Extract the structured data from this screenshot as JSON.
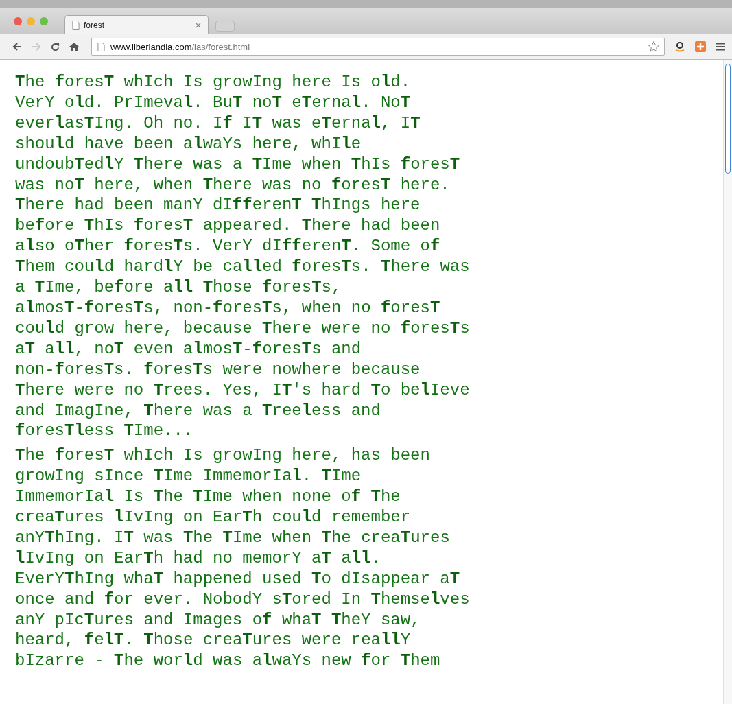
{
  "browser": {
    "tab": {
      "title": "forest"
    },
    "forward_disabled": true,
    "address": {
      "host": "www.liberlandia.com",
      "path": "/las/forest.html"
    }
  },
  "page": {
    "paragraphs": [
      {
        "lines": [
          "**T**he **f**ores**T** whIch Is growIng here Is o**l**d.",
          "VerY o**l**d. PrImeva**l**. Bu**T** no**T** e**T**erna**l**. No**T**",
          "ever**l**as**T**Ing. Oh no. I**f** I**T** was e**T**erna**l**, I**T**",
          "shou**l**d have been a**l**waYs here, whI**l**e",
          "undoub**T**ed**l**Y **T**here was a **T**Ime when **T**hIs **f**ores**T**",
          "was no**T** here, when **T**here was no **f**ores**T** here.",
          "**T**here had been manY dI**ff**eren**T** **T**hIngs here",
          "be**f**ore **T**hIs **f**ores**T** appeared. **T**here had been",
          "a**l**so o**T**her **f**ores**T**s. VerY dI**ff**eren**T**. Some o**f**",
          "**T**hem cou**l**d hard**l**Y be ca**ll**ed **f**ores**T**s. **T**here was",
          "a **T**Ime, be**f**ore a**ll** **T**hose **f**ores**T**s,",
          "a**l**mos**T**-**f**ores**T**s, non-**f**ores**T**s, when no **f**ores**T**",
          "cou**l**d grow here, because **T**here were no **f**ores**T**s",
          "a**T** a**ll**, no**T** even a**l**mos**T**-**f**ores**T**s and",
          "non-**f**ores**T**s. **f**ores**T**s were nowhere because",
          "**T**here were no **T**rees. Yes, I**T**'s hard **T**o be**l**Ieve",
          "and ImagIne, **T**here was a **T**ree**l**ess and",
          "**f**ores**Tl**ess **T**Ime..."
        ]
      },
      {
        "lines": [
          "**T**he **f**ores**T** whIch Is growIng here, has been",
          "growIng sInce **T**Ime ImmemorIa**l**. **T**Ime",
          "ImmemorIa**l** Is **T**he **T**Ime when none o**f** **T**he",
          "crea**T**ures **l**IvIng on Ear**T**h cou**l**d remember",
          "anY**T**hIng. I**T** was **T**he **T**Ime when **T**he crea**T**ures",
          "**l**IvIng on Ear**T**h had no memorY a**T** a**ll**.",
          "EverY**T**hIng wha**T** happened used **T**o dIsappear a**T**",
          "once and **f**or ever. NobodY s**T**ored In **T**hemse**l**ves",
          "anY pIc**T**ures and Images o**f** wha**T** **T**heY saw,",
          "heard, **f**e**lT**. **T**hose crea**T**ures were rea**ll**Y",
          "bIzarre - **T**he wor**l**d was a**l**waYs new **f**or **T**hem"
        ]
      }
    ]
  }
}
